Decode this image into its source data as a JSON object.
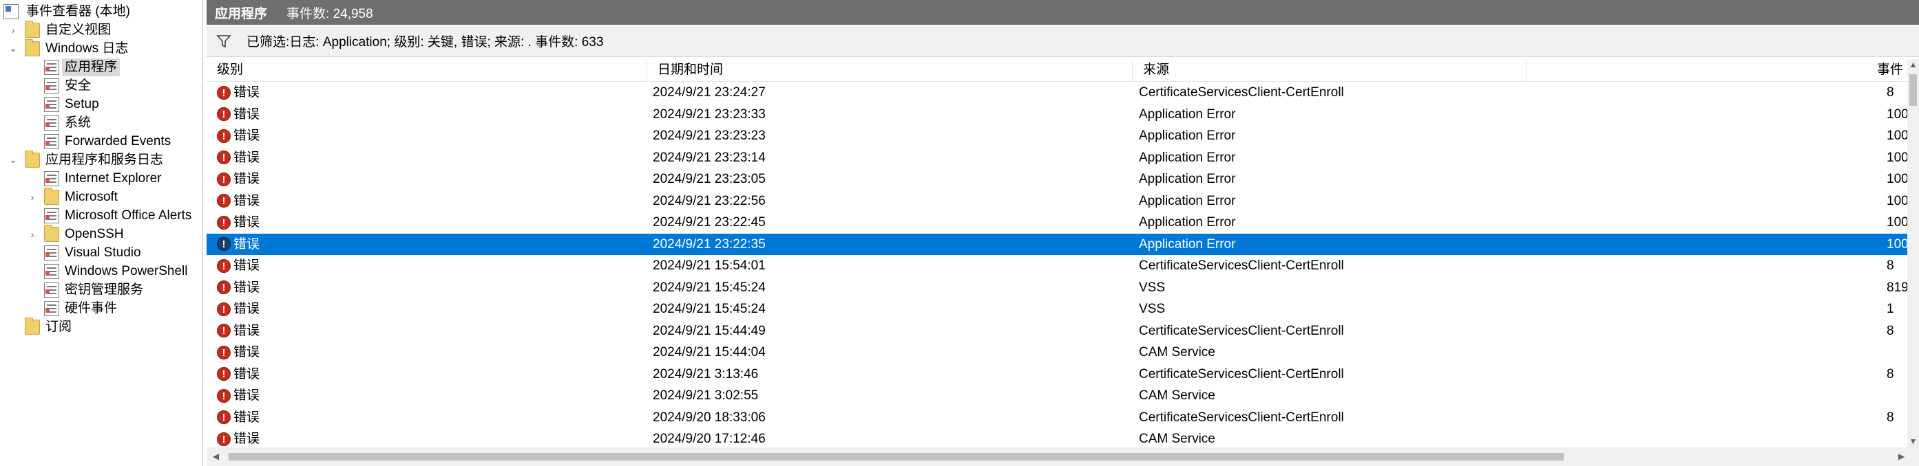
{
  "tree": {
    "root": "事件查看器 (本地)",
    "items": [
      {
        "label": "自定义视图",
        "level": 1,
        "chevron": "right",
        "icon": "folder-icon"
      },
      {
        "label": "Windows 日志",
        "level": 1,
        "chevron": "down",
        "icon": "folder-icon"
      },
      {
        "label": "应用程序",
        "level": 2,
        "chevron": "",
        "icon": "log-icon",
        "selected": true
      },
      {
        "label": "安全",
        "level": 2,
        "chevron": "",
        "icon": "log-icon"
      },
      {
        "label": "Setup",
        "level": 2,
        "chevron": "",
        "icon": "log-icon"
      },
      {
        "label": "系统",
        "level": 2,
        "chevron": "",
        "icon": "log-icon"
      },
      {
        "label": "Forwarded Events",
        "level": 2,
        "chevron": "",
        "icon": "log-icon"
      },
      {
        "label": "应用程序和服务日志",
        "level": 1,
        "chevron": "down",
        "icon": "folder-icon"
      },
      {
        "label": "Internet Explorer",
        "level": 2,
        "chevron": "",
        "icon": "log-icon"
      },
      {
        "label": "Microsoft",
        "level": 2,
        "chevron": "right",
        "icon": "folder-icon"
      },
      {
        "label": "Microsoft Office Alerts",
        "level": 2,
        "chevron": "",
        "icon": "log-icon"
      },
      {
        "label": "OpenSSH",
        "level": 2,
        "chevron": "right",
        "icon": "folder-icon"
      },
      {
        "label": "Visual Studio",
        "level": 2,
        "chevron": "",
        "icon": "log-icon"
      },
      {
        "label": "Windows PowerShell",
        "level": 2,
        "chevron": "",
        "icon": "log-icon"
      },
      {
        "label": "密钥管理服务",
        "level": 2,
        "chevron": "",
        "icon": "log-icon"
      },
      {
        "label": "硬件事件",
        "level": 2,
        "chevron": "",
        "icon": "log-icon"
      },
      {
        "label": "订阅",
        "level": 1,
        "chevron": "",
        "icon": "folder-icon"
      }
    ]
  },
  "header": {
    "title": "应用程序",
    "count": "事件数: 24,958"
  },
  "filter": {
    "icon": "filter-icon",
    "text": "已筛选:日志: Application; 级别: 关键, 错误; 来源: . 事件数: 633"
  },
  "columns": {
    "level": "级别",
    "date": "日期和时间",
    "source": "来源",
    "event_id": "事件"
  },
  "rows": [
    {
      "level": "错误",
      "date": "2024/9/21 23:24:27",
      "source": "CertificateServicesClient-CertEnroll",
      "id": "8",
      "selected": false
    },
    {
      "level": "错误",
      "date": "2024/9/21 23:23:33",
      "source": "Application Error",
      "id": "100",
      "selected": false
    },
    {
      "level": "错误",
      "date": "2024/9/21 23:23:23",
      "source": "Application Error",
      "id": "100",
      "selected": false
    },
    {
      "level": "错误",
      "date": "2024/9/21 23:23:14",
      "source": "Application Error",
      "id": "100",
      "selected": false
    },
    {
      "level": "错误",
      "date": "2024/9/21 23:23:05",
      "source": "Application Error",
      "id": "100",
      "selected": false
    },
    {
      "level": "错误",
      "date": "2024/9/21 23:22:56",
      "source": "Application Error",
      "id": "100",
      "selected": false
    },
    {
      "level": "错误",
      "date": "2024/9/21 23:22:45",
      "source": "Application Error",
      "id": "100",
      "selected": false
    },
    {
      "level": "错误",
      "date": "2024/9/21 23:22:35",
      "source": "Application Error",
      "id": "100",
      "selected": true
    },
    {
      "level": "错误",
      "date": "2024/9/21 15:54:01",
      "source": "CertificateServicesClient-CertEnroll",
      "id": "8",
      "selected": false
    },
    {
      "level": "错误",
      "date": "2024/9/21 15:45:24",
      "source": "VSS",
      "id": "819",
      "selected": false
    },
    {
      "level": "错误",
      "date": "2024/9/21 15:45:24",
      "source": "VSS",
      "id": "1",
      "selected": false
    },
    {
      "level": "错误",
      "date": "2024/9/21 15:44:49",
      "source": "CertificateServicesClient-CertEnroll",
      "id": "8",
      "selected": false
    },
    {
      "level": "错误",
      "date": "2024/9/21 15:44:04",
      "source": "CAM Service",
      "id": "",
      "selected": false
    },
    {
      "level": "错误",
      "date": "2024/9/21 3:13:46",
      "source": "CertificateServicesClient-CertEnroll",
      "id": "8",
      "selected": false
    },
    {
      "level": "错误",
      "date": "2024/9/21 3:02:55",
      "source": "CAM Service",
      "id": "",
      "selected": false
    },
    {
      "level": "错误",
      "date": "2024/9/20 18:33:06",
      "source": "CertificateServicesClient-CertEnroll",
      "id": "8",
      "selected": false
    },
    {
      "level": "错误",
      "date": "2024/9/20 17:12:46",
      "source": "CAM Service",
      "id": "",
      "selected": false
    }
  ],
  "colors": {
    "header_bg": "#6f6f6f",
    "selection": "#0078d7",
    "error_icon": "#c42b1c"
  }
}
